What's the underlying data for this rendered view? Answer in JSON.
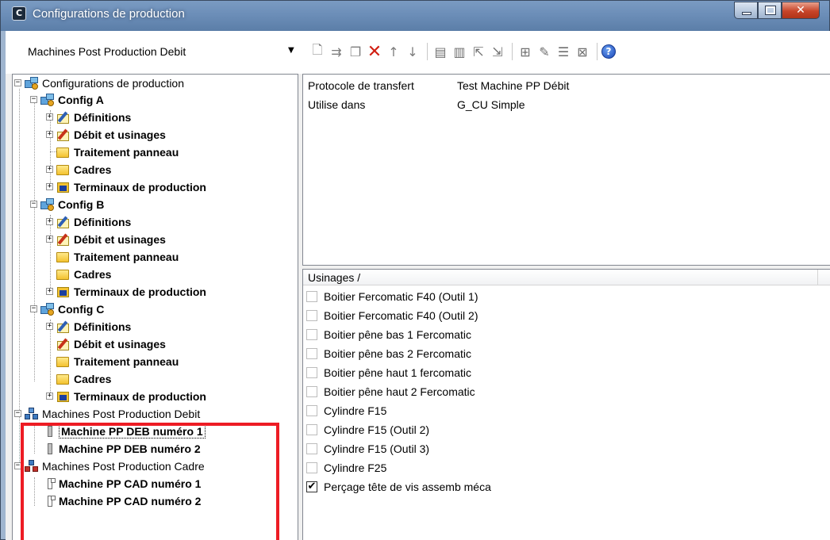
{
  "window": {
    "title": "Configurations de production",
    "icon": "app-c-icon"
  },
  "toolbar": {
    "combo_value": "Machines Post Production Debit",
    "icons": [
      "new-icon",
      "copy-special-icon",
      "copy-icon",
      "delete-icon",
      "move-up-icon",
      "move-down-icon",
      "properties-icon",
      "properties-alt-icon",
      "export-icon",
      "import-icon",
      "add-item-icon",
      "edit-item-icon",
      "list-icon",
      "remove-item-icon",
      "help-icon"
    ]
  },
  "tree": {
    "root": "Configurations de production",
    "configs": [
      {
        "label": "Config A",
        "children": [
          "Définitions",
          "Débit et usinages",
          "Traitement panneau",
          "Cadres",
          "Terminaux de production"
        ]
      },
      {
        "label": "Config B",
        "children": [
          "Définitions",
          "Débit et usinages",
          "Traitement panneau",
          "Cadres",
          "Terminaux de production"
        ]
      },
      {
        "label": "Config C",
        "children": [
          "Définitions",
          "Débit et usinages",
          "Traitement panneau",
          "Cadres",
          "Terminaux de production"
        ]
      }
    ],
    "machines_debit": {
      "label": "Machines Post Production Debit",
      "items": [
        "Machine PP DEB numéro 1",
        "Machine PP DEB numéro 2"
      ]
    },
    "machines_cadre": {
      "label": "Machines Post Production Cadre",
      "items": [
        "Machine PP CAD numéro 1",
        "Machine PP CAD numéro 2"
      ]
    }
  },
  "properties": [
    {
      "key": "Protocole de transfert",
      "value": "Test Machine PP Débit"
    },
    {
      "key": "Utilise dans",
      "value": "G_CU Simple"
    }
  ],
  "usinages": {
    "header": "Usinages /",
    "items": [
      {
        "label": "Boitier Fercomatic F40 (Outil 1)",
        "checked": false
      },
      {
        "label": "Boitier Fercomatic F40 (Outil 2)",
        "checked": false
      },
      {
        "label": "Boitier pêne bas 1 Fercomatic",
        "checked": false
      },
      {
        "label": "Boitier pêne bas 2 Fercomatic",
        "checked": false
      },
      {
        "label": "Boitier pêne haut 1 fercomatic",
        "checked": false
      },
      {
        "label": "Boitier pêne haut 2 Fercomatic",
        "checked": false
      },
      {
        "label": "Cylindre F15",
        "checked": false
      },
      {
        "label": "Cylindre F15 (Outil 2)",
        "checked": false
      },
      {
        "label": "Cylindre F15 (Outil 3)",
        "checked": false
      },
      {
        "label": "Cylindre F25",
        "checked": false
      },
      {
        "label": "Perçage tête de vis assemb méca",
        "checked": true
      }
    ]
  },
  "colors": {
    "highlight": "#ed1c24",
    "titlebar": "#6c8eb8"
  }
}
